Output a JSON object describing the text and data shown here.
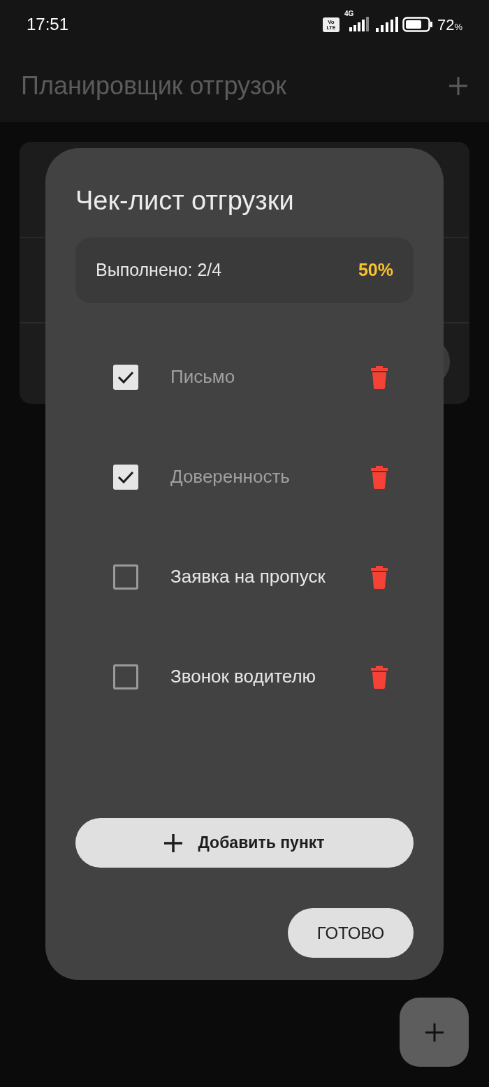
{
  "status_bar": {
    "time": "17:51",
    "volte": [
      "Vo",
      "LTE"
    ],
    "network": "4G",
    "battery": "72",
    "battery_unit": "%"
  },
  "app_bar": {
    "title": "Планировщик отгрузок"
  },
  "dialog": {
    "title": "Чек-лист отгрузки",
    "summary": {
      "label": "Выполнено: 2/4",
      "percent": "50%"
    },
    "items": [
      {
        "label": "Письмо",
        "checked": true
      },
      {
        "label": "Доверенность",
        "checked": true
      },
      {
        "label": "Заявка на пропуск",
        "checked": false
      },
      {
        "label": "Звонок водителю",
        "checked": false
      }
    ],
    "add_button": "Добавить пункт",
    "done_button": "ГОТОВО"
  }
}
